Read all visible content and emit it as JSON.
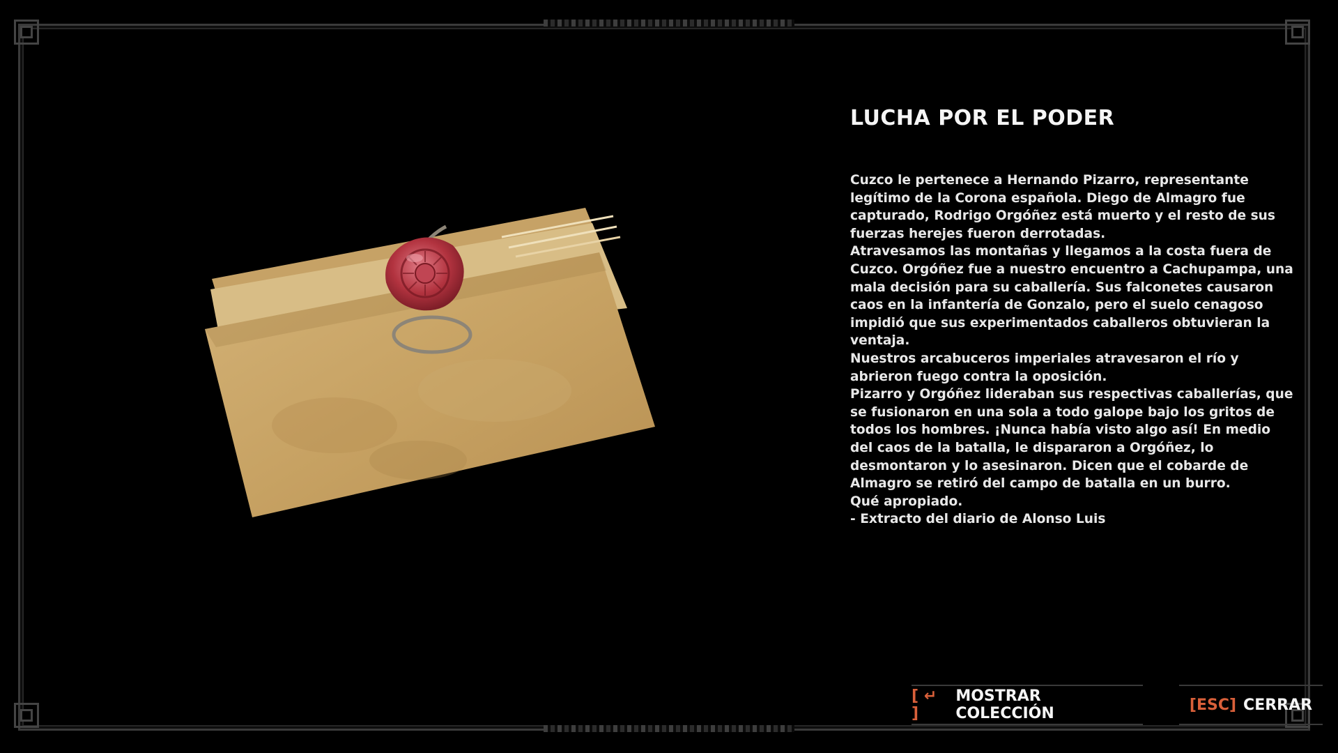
{
  "document": {
    "title": "LUCHA POR EL PODER",
    "paragraphs": [
      "Cuzco le pertenece a Hernando Pizarro, representante legítimo de la Corona española. Diego de Almagro fue capturado, Rodrigo Orgóñez está muerto y el resto de sus fuerzas herejes fueron derrotadas.",
      "Atravesamos las montañas y llegamos a la costa fuera de Cuzco. Orgóñez fue a nuestro encuentro a Cachupampa, una mala decisión para su caballería. Sus falconetes causaron caos en la infantería de Gonzalo, pero el suelo cenagoso impidió que sus experimentados caballeros obtuvieran la ventaja.",
      "Nuestros arcabuceros imperiales atravesaron el río y abrieron fuego contra la oposición.",
      "Pizarro y Orgóñez lideraban sus respectivas caballerías, que se fusionaron en una sola a todo galope bajo los gritos de todos los hombres. ¡Nunca había visto algo así! En medio del caos de la batalla, le dispararon a Orgóñez, lo desmontaron y lo asesinaron. Dicen que el cobarde de Almagro se retiró del campo de batalla en un burro.",
      "Qué apropiado.",
      "- Extracto del diario de Alonso Luis"
    ]
  },
  "prompts": {
    "collection": {
      "key": "[ ↵ ]",
      "label": "MOSTRAR COLECCIÓN"
    },
    "close": {
      "key": "[ESC]",
      "label": "CERRAR"
    }
  },
  "colors": {
    "accent_key": "#d9603a",
    "paper": "#c9a465",
    "wax_seal": "#b2333f"
  },
  "icons": {
    "enter": "enter-key-icon",
    "item": "sealed-letter"
  }
}
